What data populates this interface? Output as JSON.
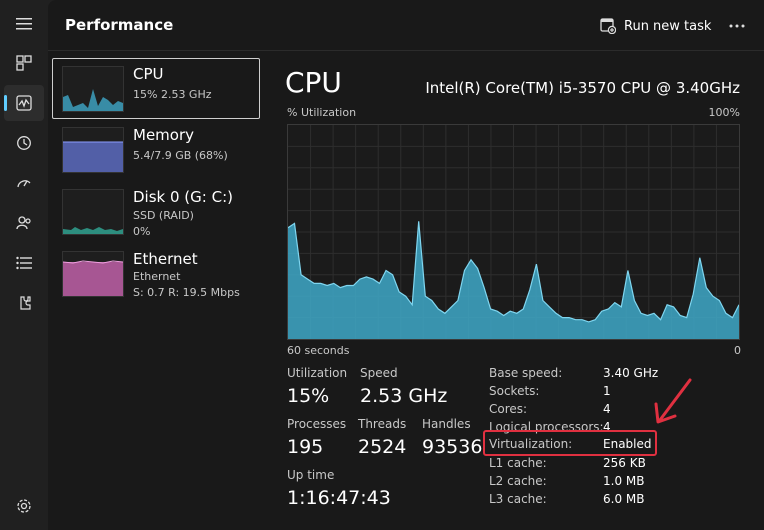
{
  "header": {
    "title": "Performance",
    "run_task_label": "Run new task"
  },
  "rail": {
    "items": [
      "hamburger-icon",
      "processes-icon",
      "performance-icon",
      "history-icon",
      "startup-icon",
      "users-icon",
      "details-icon",
      "services-icon"
    ],
    "settings": "settings-icon"
  },
  "devices": [
    {
      "name": "CPU",
      "sub1": "15%  2.53 GHz",
      "color": "#3ea8c8"
    },
    {
      "name": "Memory",
      "sub1": "5.4/7.9 GB (68%)",
      "color": "#5c6bc0"
    },
    {
      "name": "Disk 0 (G: C:)",
      "sub1": "SSD (RAID)",
      "sub2": "0%",
      "color": "#2f9a8a"
    },
    {
      "name": "Ethernet",
      "sub1": "Ethernet",
      "sub2": "S: 0.7  R: 19.5 Mbps",
      "color": "#c060a8"
    }
  ],
  "detail": {
    "title": "CPU",
    "model": "Intel(R) Core(TM) i5-3570 CPU @ 3.40GHz",
    "graph_y_label": "% Utilization",
    "graph_y_max": "100%",
    "graph_x_left": "60 seconds",
    "graph_x_right": "0",
    "graph_color": "#3ea8c8",
    "utilization_series": [
      52,
      54,
      30,
      28,
      26,
      26,
      25,
      26,
      24,
      25,
      25,
      28,
      29,
      28,
      26,
      32,
      30,
      22,
      20,
      16,
      55,
      20,
      18,
      14,
      12,
      15,
      18,
      32,
      37,
      33,
      24,
      14,
      13,
      11,
      13,
      12,
      14,
      23,
      35,
      18,
      15,
      12,
      10,
      10,
      9,
      9,
      8,
      9,
      13,
      14,
      17,
      15,
      32,
      18,
      12,
      11,
      12,
      9,
      16,
      15,
      11,
      10,
      21,
      38,
      24,
      20,
      18,
      12,
      10,
      16
    ],
    "stats": {
      "utilization_label": "Utilization",
      "utilization_value": "15%",
      "speed_label": "Speed",
      "speed_value": "2.53 GHz",
      "processes_label": "Processes",
      "processes_value": "195",
      "threads_label": "Threads",
      "threads_value": "2524",
      "handles_label": "Handles",
      "handles_value": "93536",
      "uptime_label": "Up time",
      "uptime_value": "1:16:47:43"
    },
    "specs": [
      {
        "k": "Base speed:",
        "v": "3.40 GHz"
      },
      {
        "k": "Sockets:",
        "v": "1"
      },
      {
        "k": "Cores:",
        "v": "4"
      },
      {
        "k": "Logical processors:",
        "v": "4"
      },
      {
        "k": "Virtualization:",
        "v": "Enabled"
      },
      {
        "k": "L1 cache:",
        "v": "256 KB"
      },
      {
        "k": "L2 cache:",
        "v": "1.0 MB"
      },
      {
        "k": "L3 cache:",
        "v": "6.0 MB"
      }
    ]
  }
}
